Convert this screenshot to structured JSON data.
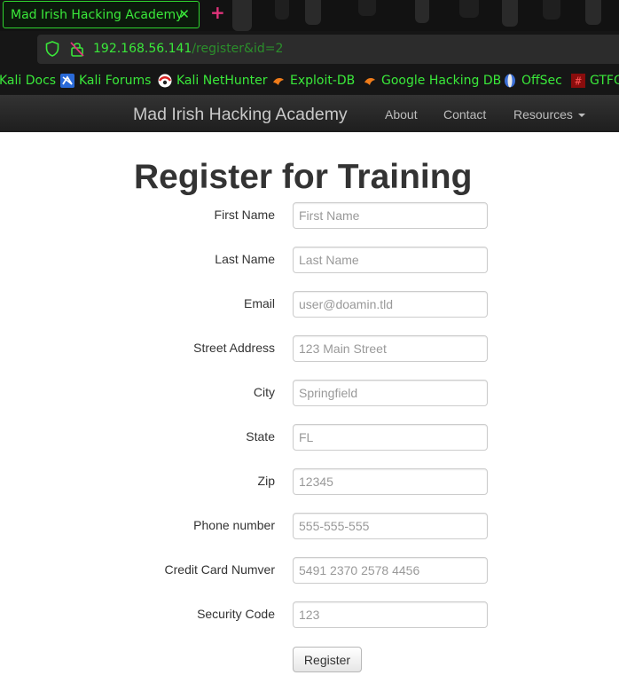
{
  "browser": {
    "tab": {
      "title": "Mad Irish Hacking Academy",
      "close_icon": "close-icon"
    },
    "new_tab_icon": "plus-icon",
    "address": {
      "host": "192.168.56.141",
      "path": "/register&id=2"
    },
    "bookmarks": [
      {
        "label": "Kali Docs",
        "icon": "kali-icon"
      },
      {
        "label": "Kali Forums",
        "icon": "kali-forums-icon"
      },
      {
        "label": "Kali NetHunter",
        "icon": "nethunter-icon"
      },
      {
        "label": "Exploit-DB",
        "icon": "exploitdb-icon"
      },
      {
        "label": "Google Hacking DB",
        "icon": "exploitdb-icon"
      },
      {
        "label": "OffSec",
        "icon": "offsec-icon"
      },
      {
        "label": "GTFO",
        "icon": "gtfobins-icon"
      }
    ]
  },
  "navbar": {
    "brand": "Mad Irish Hacking Academy",
    "links": [
      "About",
      "Contact",
      "Resources"
    ]
  },
  "page": {
    "title": "Register for Training",
    "fields": [
      {
        "label": "First Name",
        "placeholder": "First Name"
      },
      {
        "label": "Last Name",
        "placeholder": "Last Name"
      },
      {
        "label": "Email",
        "placeholder": "user@doamin.tld"
      },
      {
        "label": "Street Address",
        "placeholder": "123 Main Street"
      },
      {
        "label": "City",
        "placeholder": "Springfield"
      },
      {
        "label": "State",
        "placeholder": "FL"
      },
      {
        "label": "Zip",
        "placeholder": "12345"
      },
      {
        "label": "Phone number",
        "placeholder": "555-555-555"
      },
      {
        "label": "Credit Card Numver",
        "placeholder": "5491 2370 2578 4456"
      },
      {
        "label": "Security Code",
        "placeholder": "123"
      }
    ],
    "submit_label": "Register"
  },
  "colors": {
    "kali_green": "#3ae83a",
    "tab_plus": "#e0337a",
    "navbar_bg": "#222222",
    "heading": "#333333"
  }
}
